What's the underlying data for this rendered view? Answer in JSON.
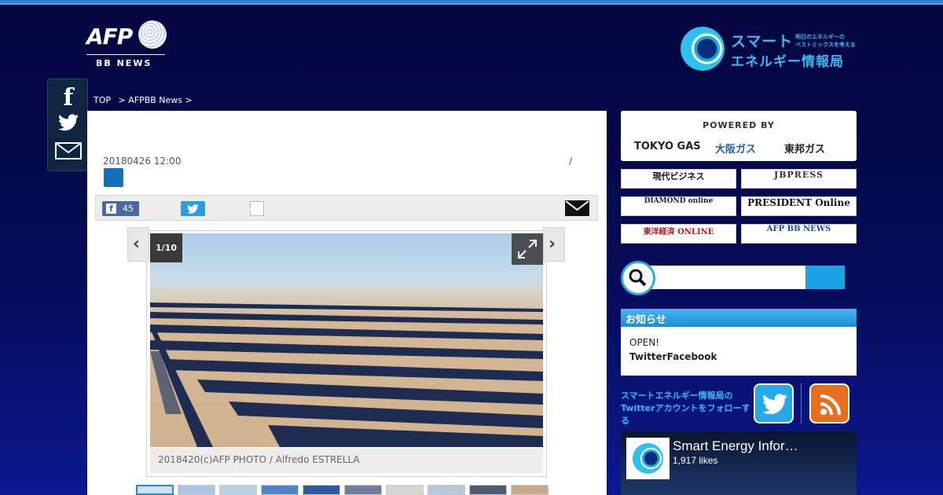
{
  "header": {
    "afp_logo_text": "AFP",
    "afp_logo_sub": "BB NEWS",
    "site_title_line1": "スマート",
    "site_title_line2": "エネルギー情報局",
    "site_tagline_line1": "明日のエネルギーの",
    "site_tagline_line2": "ベストミックスを考える"
  },
  "social_bar": {
    "facebook_icon": "facebook-icon",
    "twitter_icon": "twitter-icon",
    "mail_icon": "mail-icon"
  },
  "breadcrumb": {
    "items": [
      "TOP",
      "> AFPBB News >"
    ]
  },
  "article": {
    "date": "20180426 12:00",
    "slash": "/",
    "share": {
      "facebook_count": "45"
    },
    "gallery": {
      "counter": "1/10",
      "caption": "2018420(c)AFP PHOTO / Alfredo ESTRELLA",
      "prev_label": "‹",
      "next_label": "›"
    }
  },
  "sidebar": {
    "powered_by": "POWERED BY",
    "sponsors": [
      "TOKYO GAS",
      "大阪ガス",
      "東邦ガス"
    ],
    "partners": [
      "現代ビジネス",
      "JBPRESS",
      "DIAMOND online",
      "PRESIDENT Online",
      "東洋経済 ONLINE",
      "AFP BB NEWS"
    ],
    "notice": {
      "heading": "お知らせ",
      "line1": "OPEN!",
      "line2": "TwitterFacebook"
    },
    "follow_text": "スマートエネルギー情報局の Twitterアカウントをフォローする",
    "fb_page": {
      "name": "Smart Energy Infor…",
      "likes": "1,917 likes"
    }
  },
  "colors": {
    "background": "#03063e",
    "accent_blue": "#1da2e6",
    "facebook": "#4a67a8",
    "twitter": "#2c9de0",
    "rss": "#e86e1f"
  }
}
